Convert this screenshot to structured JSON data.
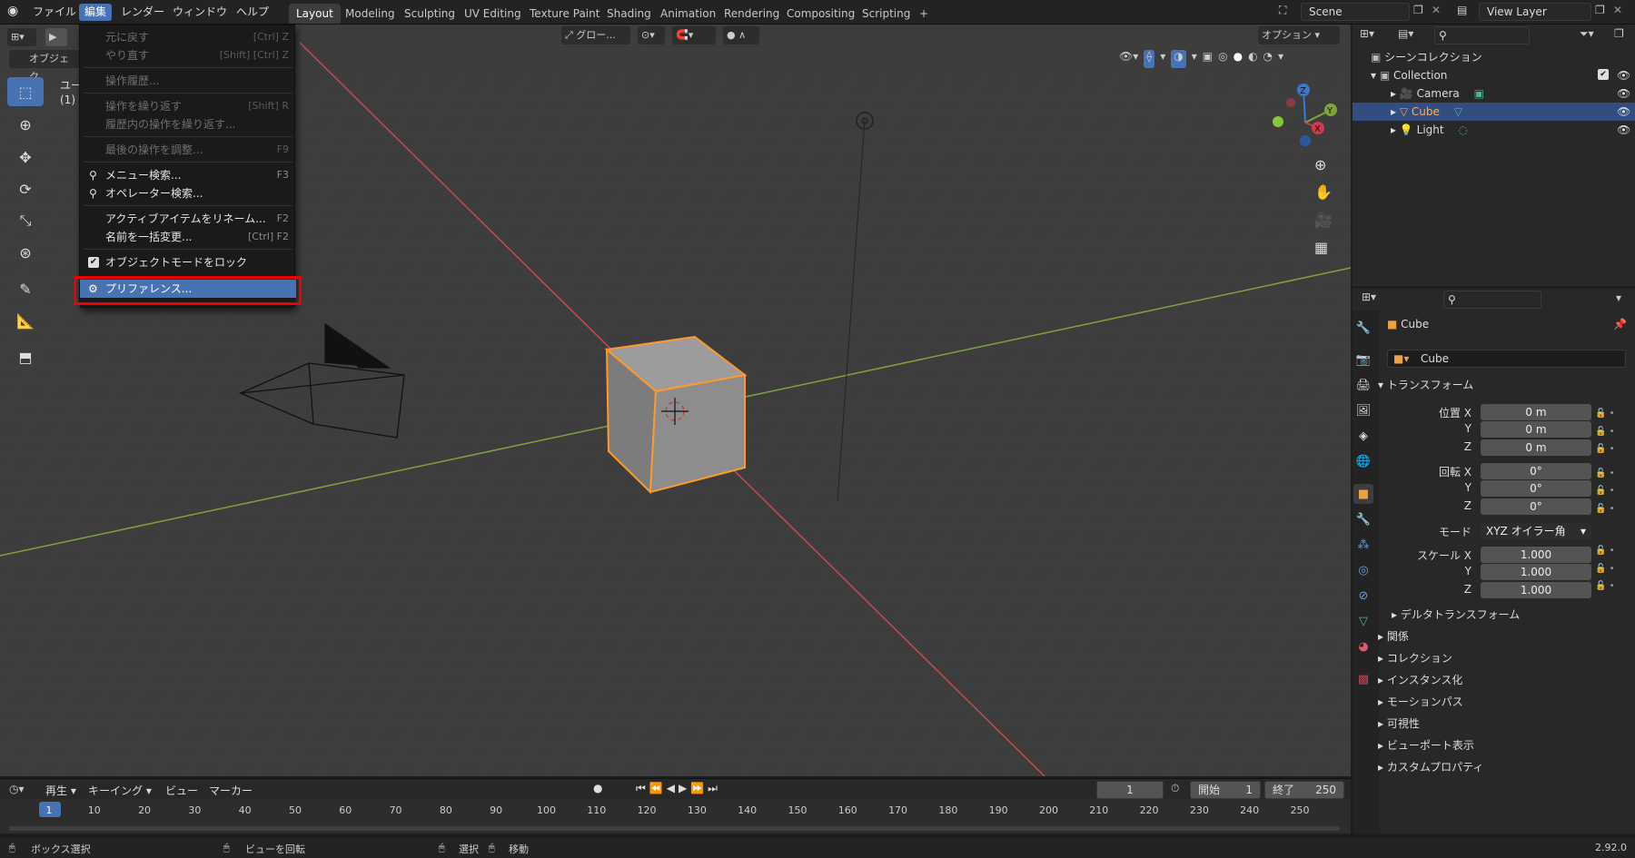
{
  "topbar": {
    "menus": [
      "ファイル",
      "編集",
      "レンダー",
      "ウィンドウ",
      "ヘルプ"
    ],
    "workspaces": [
      "Layout",
      "Modeling",
      "Sculpting",
      "UV Editing",
      "Texture Paint",
      "Shading",
      "Animation",
      "Rendering",
      "Compositing",
      "Scripting",
      "+"
    ],
    "scene": "Scene",
    "view_layer": "View Layer"
  },
  "viewport": {
    "mode_label": "オブジェク",
    "info1": "ユー",
    "info2": "(1) C",
    "orientation": "グロー...",
    "options": "オプション"
  },
  "edit_menu": {
    "items": [
      {
        "label": "元に戻す",
        "shortcut": "[Ctrl] Z",
        "disabled": true
      },
      {
        "label": "やり直す",
        "shortcut": "[Shift] [Ctrl] Z",
        "disabled": true
      },
      {
        "label": "操作履歴...",
        "shortcut": "",
        "disabled": true
      },
      {
        "label": "操作を繰り返す",
        "shortcut": "[Shift] R",
        "disabled": true
      },
      {
        "label": "履歴内の操作を繰り返す...",
        "shortcut": "",
        "disabled": true
      },
      {
        "label": "最後の操作を調整...",
        "shortcut": "F9",
        "disabled": true
      },
      {
        "label": "メニュー検索...",
        "shortcut": "F3",
        "disabled": false
      },
      {
        "label": "オペレーター検索...",
        "shortcut": "",
        "disabled": false
      },
      {
        "label": "アクティブアイテムをリネーム...",
        "shortcut": "F2",
        "disabled": false
      },
      {
        "label": "名前を一括変更...",
        "shortcut": "[Ctrl] F2",
        "disabled": false
      },
      {
        "label": "オブジェクトモードをロック",
        "shortcut": "",
        "disabled": false
      },
      {
        "label": "プリファレンス...",
        "shortcut": "",
        "disabled": false
      }
    ]
  },
  "outliner": {
    "root": "シーンコレクション",
    "collection": "Collection",
    "objects": [
      "Camera",
      "Cube",
      "Light"
    ]
  },
  "properties": {
    "object_name": "Cube",
    "data_name": "Cube",
    "transform_title": "トランスフォーム",
    "loc_label_x": "位置 X",
    "y": "Y",
    "z": "Z",
    "rot_label_x": "回転 X",
    "scale_label_x": "スケール X",
    "mode_label": "モード",
    "mode_value": "XYZ オイラー角",
    "loc": [
      "0 m",
      "0 m",
      "0 m"
    ],
    "rot": [
      "0°",
      "0°",
      "0°"
    ],
    "scale": [
      "1.000",
      "1.000",
      "1.000"
    ],
    "delta": "デルタトランスフォーム",
    "panels": [
      "関係",
      "コレクション",
      "インスタンス化",
      "モーションパス",
      "可視性",
      "ビューポート表示",
      "カスタムプロパティ"
    ]
  },
  "timeline": {
    "menus": [
      "再生",
      "キーイング",
      "ビュー",
      "マーカー"
    ],
    "current": "1",
    "start_label": "開始",
    "start": "1",
    "end_label": "終了",
    "end": "250",
    "ticks": [
      "1",
      "10",
      "20",
      "30",
      "40",
      "50",
      "60",
      "70",
      "80",
      "90",
      "100",
      "110",
      "120",
      "130",
      "140",
      "150",
      "160",
      "170",
      "180",
      "190",
      "200",
      "210",
      "220",
      "230",
      "240",
      "250"
    ]
  },
  "statusbar": {
    "box_select": "ボックス選択",
    "rotate_view": "ビューを回転",
    "select": "選択",
    "move": "移動",
    "version": "2.92.0"
  },
  "colors": {
    "accent": "#4772b3",
    "highlight_box": "#e00000",
    "selection_outline": "#ff9a2a"
  }
}
